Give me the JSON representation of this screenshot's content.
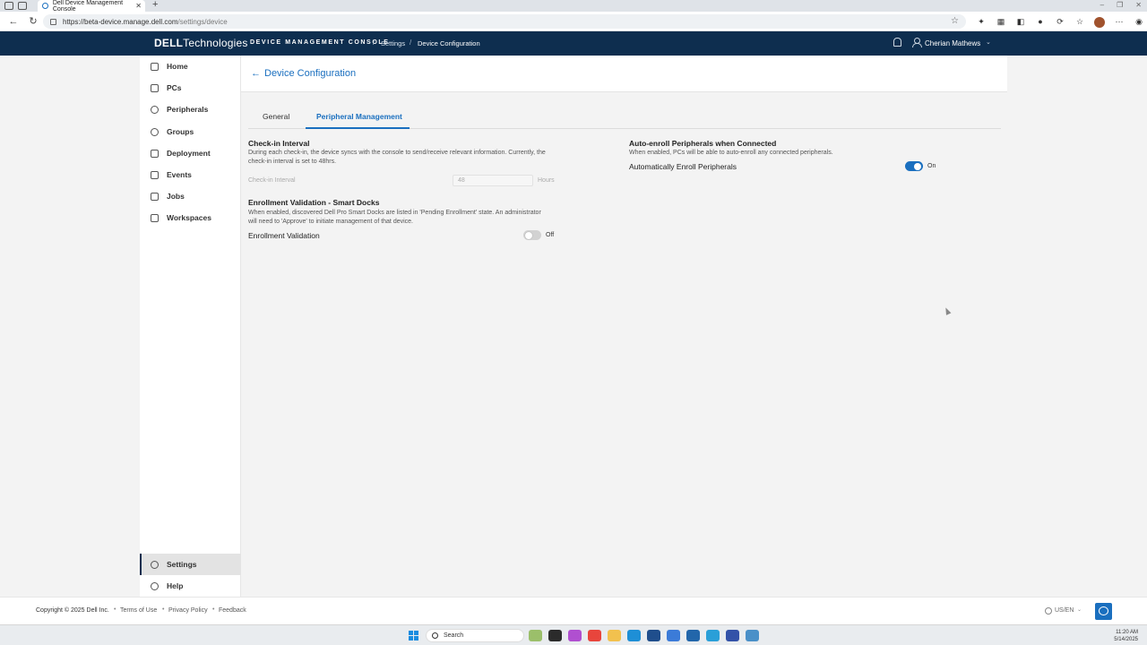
{
  "browser": {
    "tab_title": "Dell Device Management Console",
    "tab_close": "✕",
    "new_tab": "+",
    "window_controls": [
      "–",
      "❐",
      "✕"
    ],
    "url_host": "https://beta-device.manage.dell.com",
    "url_path": "/settings/device"
  },
  "header": {
    "logo_brand": "DELL",
    "logo_suffix": "Technologies",
    "console_title": "DEVICE MANAGEMENT CONSOLE",
    "sep": "/",
    "breadcrumb": [
      "Settings",
      "Device Configuration"
    ],
    "user_name": "Cherian Mathews",
    "user_chevron": "⌄"
  },
  "sidebar": {
    "items": [
      {
        "label": "Home",
        "icon": "home-icon"
      },
      {
        "label": "PCs",
        "icon": "laptop-icon"
      },
      {
        "label": "Peripherals",
        "icon": "mouse-icon"
      },
      {
        "label": "Groups",
        "icon": "groups-icon"
      },
      {
        "label": "Deployment",
        "icon": "deployment-icon"
      },
      {
        "label": "Events",
        "icon": "events-icon"
      },
      {
        "label": "Jobs",
        "icon": "jobs-icon"
      },
      {
        "label": "Workspaces",
        "icon": "workspaces-icon"
      }
    ],
    "bottom_items": [
      {
        "label": "Settings",
        "icon": "gear-icon",
        "active": true
      },
      {
        "label": "Help",
        "icon": "help-icon"
      }
    ]
  },
  "page": {
    "back_arrow": "←",
    "title": "Device Configuration",
    "tabs": [
      {
        "label": "General",
        "active": false
      },
      {
        "label": "Peripheral Management",
        "active": true
      }
    ],
    "checkin": {
      "title": "Check-in Interval",
      "desc_line1": "During each check-in, the device syncs with the console to send/receive relevant information. Currently, the",
      "desc_line2": "check-in interval is set to 48hrs.",
      "field_label": "Check-in Interval",
      "field_value": "48",
      "field_unit": "Hours"
    },
    "enrollment": {
      "title": "Enrollment Validation - Smart Docks",
      "desc_line1": "When enabled, discovered Dell Pro Smart Docks are listed in 'Pending Enrollment' state. An administrator",
      "desc_line2": "will need to 'Approve' to initiate management of that device.",
      "row_label": "Enrollment Validation",
      "toggle_state": "Off"
    },
    "autoenroll": {
      "title": "Auto-enroll Peripherals when Connected",
      "desc": "When enabled, PCs will be able to auto-enroll any connected peripherals.",
      "row_label": "Automatically Enroll Peripherals",
      "toggle_state": "On"
    }
  },
  "footer": {
    "copyright": "Copyright © 2025 Dell Inc.",
    "dot": "•",
    "links": [
      "Terms of Use",
      "Privacy Policy",
      "Feedback"
    ],
    "locale": "US/EN",
    "locale_chevron": "⌄"
  },
  "taskbar": {
    "search_label": "Search",
    "time": "11:20 AM",
    "date": "5/14/2025"
  },
  "colors": {
    "header_bg": "#0e2e4f",
    "accent": "#1a6fbf"
  }
}
